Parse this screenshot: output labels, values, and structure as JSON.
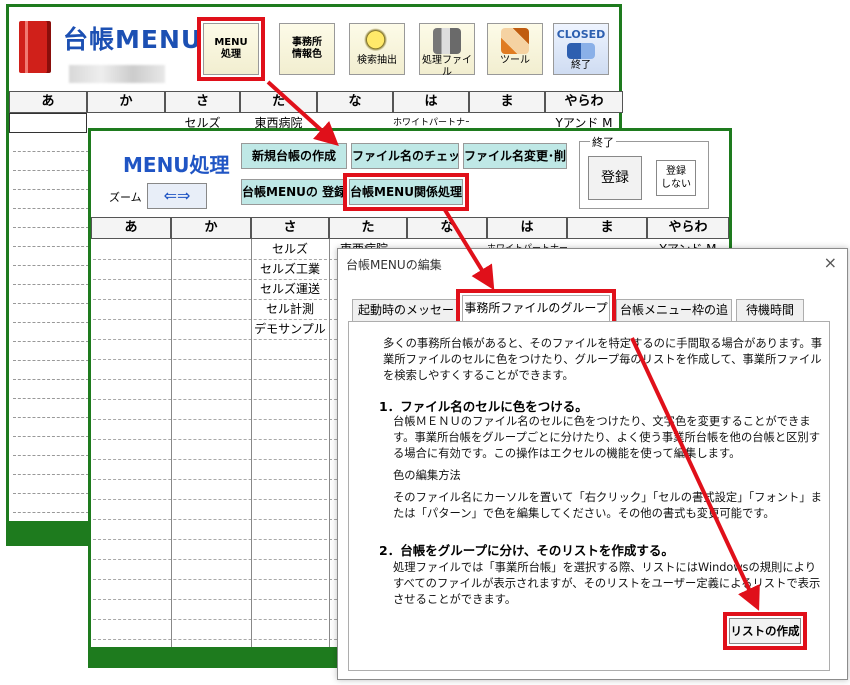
{
  "back_window": {
    "logo_title": "台帳MENU",
    "toolbar": [
      {
        "label": "MENU\n処理",
        "icon": "menu-process-icon"
      },
      {
        "label": "事務所\n情報色",
        "icon": "office-info-icon"
      },
      {
        "label": "検索抽出",
        "icon": "magnifier-icon"
      },
      {
        "label": "処理ファイル",
        "icon": "person-file-icon"
      },
      {
        "label": "ツール",
        "icon": "tools-icon"
      },
      {
        "label": "終了",
        "icon": "closed-exit-icon",
        "badge": "CLOSED"
      }
    ],
    "columns": [
      "あ",
      "か",
      "さ",
      "た",
      "な",
      "は",
      "ま",
      "やらわ"
    ],
    "row1": [
      "",
      "",
      "セルズ",
      "東西病院",
      "",
      "ホワイトパートナー",
      "",
      "Yアンド M"
    ]
  },
  "middle_window": {
    "title": "MENU処理",
    "zoom_label": "ズーム",
    "buttons": {
      "new_ledger": "新規台帳の作成",
      "file_name_check": "ファイル名のチェッ",
      "file_name_change": "ファイル名変更･削",
      "menu_register": "台帳MENUの 登録",
      "menu_related": "台帳MENU関係処理"
    },
    "end_group": {
      "label": "終了",
      "register": "登録",
      "no_register": "登録\nしない"
    },
    "columns": [
      "あ",
      "か",
      "さ",
      "た",
      "な",
      "は",
      "ま",
      "やらわ"
    ],
    "sa_column": [
      "セルズ",
      "セルズ工業",
      "セルズ運送",
      "セル計測",
      "デモサンプル"
    ],
    "row1": {
      "ta": "東西病院",
      "ha": "ホワイトパートナー",
      "yarawa": "Yアンド M"
    }
  },
  "dialog": {
    "title": "台帳MENUの編集",
    "close": "×",
    "tabs": [
      "起動時のメッセージ",
      "事務所ファイルのグループ分",
      "台帳メニュー枠の追加",
      "待機時間"
    ],
    "intro": "多くの事務所台帳があると、そのファイルを特定するのに手間取る場合があります。事業所ファイルのセルに色をつけたり、グループ毎のリストを作成して、事業所ファイルを検索しやすくすることができます。",
    "section1_heading": "1．ファイル名のセルに色をつける。",
    "section1_body": "台帳ＭＥＮＵのファイル名のセルに色をつけたり、文字色を変更することができます。事業所台帳をグループごとに分けたり、よく使う事業所台帳を他の台帳と区別する場合に有効です。この操作はエクセルの機能を使って編集します。",
    "color_method_label": "色の編集方法",
    "color_method_body": "そのファイル名にカーソルを置いて「右クリック」「セルの書式設定」「フォント」または「パターン」で色を編集してください。その他の書式も変更可能です。",
    "section2_heading": "2．台帳をグループに分け、そのリストを作成する。",
    "section2_body": "処理ファイルでは「事業所台帳」を選択する際、リストにはWindowsの規則によりすべてのファイルが表示されますが、そのリストをユーザー定義によるリストで表示させることができます。",
    "list_button": "リストの作成"
  },
  "colors": {
    "frame_green": "#1e7b1e",
    "highlight_red": "#e0101a",
    "menu_button_teal": "#bfe8e6",
    "title_blue": "#2055c4"
  }
}
